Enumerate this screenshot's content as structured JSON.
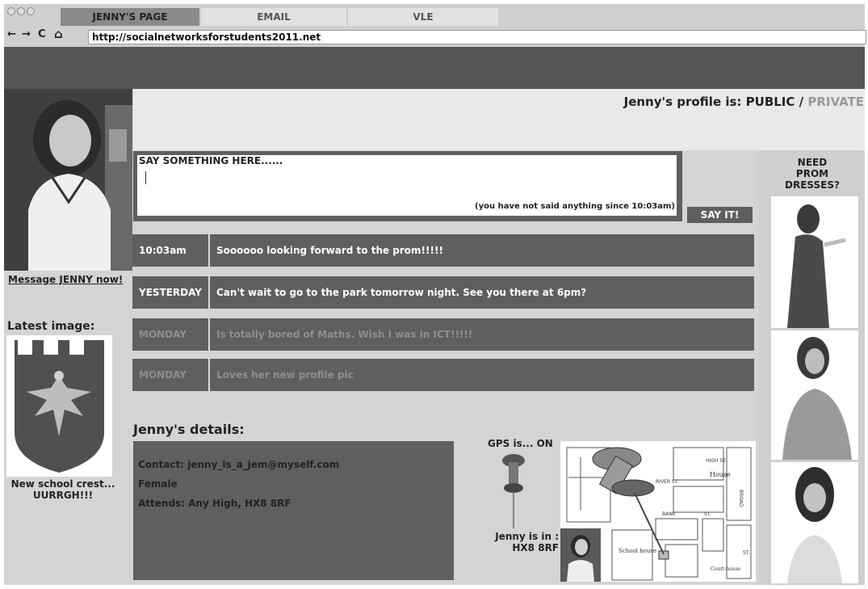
{
  "browser": {
    "tabs": [
      "JENNY'S PAGE",
      "EMAIL",
      "VLE"
    ],
    "back": "←",
    "forward": "→",
    "reload": "C",
    "home": "⌂",
    "url": "http://socialnetworksforstudents2011.net"
  },
  "profile": {
    "status_prefix": "Jenny's profile is:",
    "public_label": "PUBLIC",
    "separator": "/",
    "private_label": "PRIVATE",
    "message_link": "Message JENNY now!",
    "latest_image_label": "Latest image:",
    "image_caption_1": "New school crest...",
    "image_caption_2": "UURRGH!!!"
  },
  "compose": {
    "header": "SAY SOMETHING HERE......",
    "note": "(you have not said anything since 10:03am)",
    "submit": "SAY IT!"
  },
  "posts": [
    {
      "when": "10:03am",
      "text": "Soooooo looking forward to the prom!!!!!"
    },
    {
      "when": "YESTERDAY",
      "text": "Can't wait to go to the park tomorrow night. See you there at 6pm?"
    },
    {
      "when": "MONDAY",
      "text": "Is totally bored of Maths. Wish I was in ICT!!!!!"
    },
    {
      "when": "MONDAY",
      "text": "Loves her new profile pic"
    }
  ],
  "details": {
    "heading": "Jenny's details:",
    "contact": "Contact: jenny_is_a_jem@myself.com",
    "gender": "Female",
    "attends": "Attends: Any High, HX8 8RF"
  },
  "gps": {
    "status": "GPS is... ON",
    "location_1": "Jenny is in :",
    "location_2": "HX8 8RF",
    "map_labels": [
      "HIGH ST.",
      "House",
      "RIVER ST.",
      "BANK",
      "ST.",
      "School house",
      "Court-house",
      "BROAD",
      "ST."
    ]
  },
  "ad": {
    "line1": "NEED",
    "line2": "PROM",
    "line3": "DRESSES?"
  },
  "colors": {
    "dark_panel": "#5f5f5f",
    "page_bg": "#d4d4d4",
    "private_text": "#9a9a9a"
  }
}
